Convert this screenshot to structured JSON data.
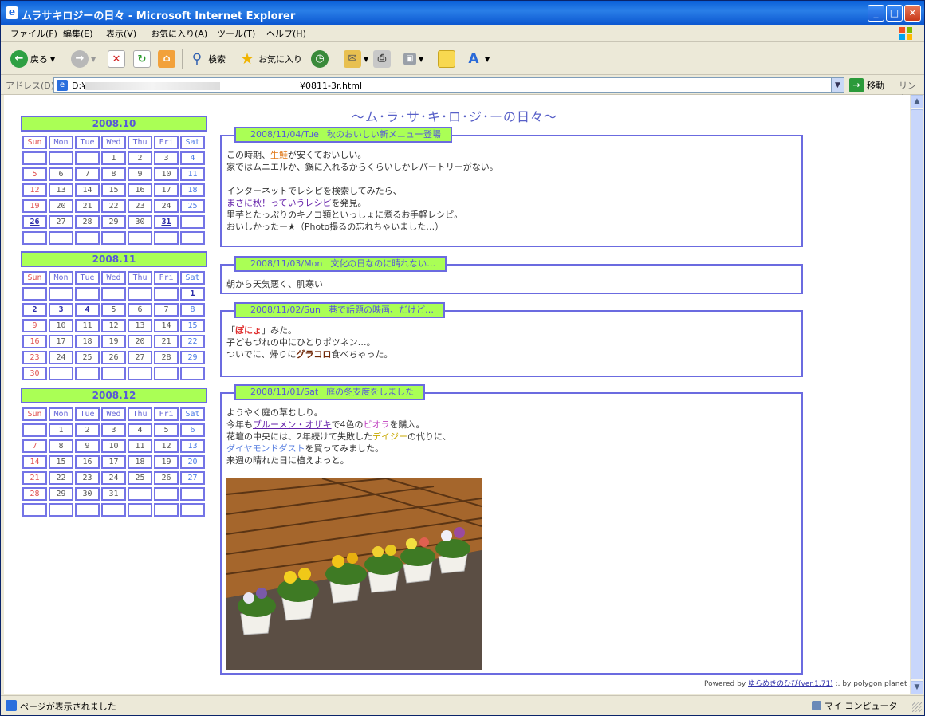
{
  "window": {
    "title": "ムラサキロジーの日々 - Microsoft Internet Explorer",
    "controls": {
      "minimize": "_",
      "maximize": "□",
      "close": "✕"
    }
  },
  "menu": [
    "ファイル(F)",
    "編集(E)",
    "表示(V)",
    "お気に入り(A)",
    "ツール(T)",
    "ヘルプ(H)"
  ],
  "toolbar": {
    "back": "戻る",
    "search": "検索",
    "favorites": "お気に入り"
  },
  "address": {
    "label": "アドレス(D)",
    "value_start": "D:¥",
    "value_end": "¥0811-3r.html",
    "go": "移動",
    "links": "リンク"
  },
  "status": {
    "text": "ページが表示されました",
    "zone": "マイ コンピュータ"
  },
  "page": {
    "title": "～ム･ラ･サ･キ･ロ･ジ･ーの日々～",
    "dow": [
      "Sun",
      "Mon",
      "Tue",
      "Wed",
      "Thu",
      "Fri",
      "Sat"
    ],
    "calendars": [
      {
        "title": "2008.10",
        "days": [
          "",
          "",
          "",
          "1",
          "2",
          "3",
          "4",
          "5",
          "6",
          "7",
          "8",
          "9",
          "10",
          "11",
          "12",
          "13",
          "14",
          "15",
          "16",
          "17",
          "18",
          "19",
          "20",
          "21",
          "22",
          "23",
          "24",
          "25",
          "26",
          "27",
          "28",
          "29",
          "30",
          "31",
          "",
          "",
          "",
          "",
          "",
          "",
          "",
          ""
        ],
        "links": [
          "26",
          "31"
        ]
      },
      {
        "title": "2008.11",
        "days": [
          "",
          "",
          "",
          "",
          "",
          "",
          "1",
          "2",
          "3",
          "4",
          "5",
          "6",
          "7",
          "8",
          "9",
          "10",
          "11",
          "12",
          "13",
          "14",
          "15",
          "16",
          "17",
          "18",
          "19",
          "20",
          "21",
          "22",
          "23",
          "24",
          "25",
          "26",
          "27",
          "28",
          "29",
          "30",
          "",
          "",
          "",
          "",
          "",
          ""
        ],
        "links": [
          "1",
          "2",
          "3",
          "4"
        ]
      },
      {
        "title": "2008.12",
        "days": [
          "",
          "1",
          "2",
          "3",
          "4",
          "5",
          "6",
          "7",
          "8",
          "9",
          "10",
          "11",
          "12",
          "13",
          "14",
          "15",
          "16",
          "17",
          "18",
          "19",
          "20",
          "21",
          "22",
          "23",
          "24",
          "25",
          "26",
          "27",
          "28",
          "29",
          "30",
          "31",
          "",
          "",
          "",
          "",
          "",
          "",
          "",
          "",
          "",
          ""
        ],
        "links": []
      }
    ],
    "entries": [
      {
        "date": "2008/11/04/Tue",
        "title": "秋のおいしい新メニュー登場",
        "lines": [
          {
            "pre": "この時期、",
            "hl": "生鮭",
            "post": "が安くておいしい。"
          },
          {
            "pre": "家ではムニエルか、鍋に入れるからくらいしかレパートリーがない。"
          },
          {
            "pre": ""
          },
          {
            "pre": "インターネットでレシピを検索してみたら、"
          },
          {
            "link": "まさに秋！っていうレシピ",
            "post": "を発見。"
          },
          {
            "pre": "里芋とたっぷりのキノコ類といっしょに煮るお手軽レシピ。"
          },
          {
            "pre": "おいしかったー★（Photo撮るの忘れちゃいました…）"
          }
        ]
      },
      {
        "date": "2008/11/03/Mon",
        "title": "文化の日なのに晴れない…",
        "lines": [
          {
            "pre": "朝から天気悪く、肌寒い"
          }
        ]
      },
      {
        "date": "2008/11/02/Sun",
        "title": "巷で話題の映画、だけど…",
        "lines": [
          {
            "pre": "「",
            "hl": "ぽにょ",
            "post": "」みた。"
          },
          {
            "pre": "子どもづれの中にひとりポツネン…。"
          },
          {
            "pre": "ついでに、帰りに",
            "hl2": "グラコロ",
            "post": "食べちゃった。"
          }
        ]
      },
      {
        "date": "2008/11/01/Sat",
        "title": "庭の冬支度をしました",
        "lines": [
          {
            "pre": "ようやく庭の草むしり。"
          },
          {
            "pre": "今年も",
            "link": "ブルーメン・オザキ",
            "post": "で4色の",
            "hl": "ビオラ",
            "post2": "を購入。"
          },
          {
            "pre": "花壇の中央には、2年続けて失敗した",
            "hl3": "デイジー",
            "post": "の代りに、"
          },
          {
            "hl4": "ダイヤモンドダスト",
            "post": "を買ってみました。"
          },
          {
            "pre": "来週の晴れた日に植えよっと。"
          }
        ]
      }
    ],
    "footer": {
      "pre": "Powered by ",
      "link": "ゆらめきのひび(ver.1.71)",
      "post": " :. by polygon planet ▲"
    }
  }
}
